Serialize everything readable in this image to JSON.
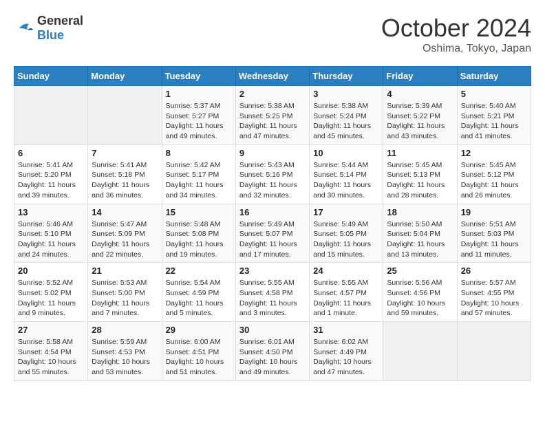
{
  "logo": {
    "general": "General",
    "blue": "Blue"
  },
  "title": {
    "month_year": "October 2024",
    "location": "Oshima, Tokyo, Japan"
  },
  "weekdays": [
    "Sunday",
    "Monday",
    "Tuesday",
    "Wednesday",
    "Thursday",
    "Friday",
    "Saturday"
  ],
  "weeks": [
    [
      {
        "day": "",
        "detail": ""
      },
      {
        "day": "",
        "detail": ""
      },
      {
        "day": "1",
        "detail": "Sunrise: 5:37 AM\nSunset: 5:27 PM\nDaylight: 11 hours and 49 minutes."
      },
      {
        "day": "2",
        "detail": "Sunrise: 5:38 AM\nSunset: 5:25 PM\nDaylight: 11 hours and 47 minutes."
      },
      {
        "day": "3",
        "detail": "Sunrise: 5:38 AM\nSunset: 5:24 PM\nDaylight: 11 hours and 45 minutes."
      },
      {
        "day": "4",
        "detail": "Sunrise: 5:39 AM\nSunset: 5:22 PM\nDaylight: 11 hours and 43 minutes."
      },
      {
        "day": "5",
        "detail": "Sunrise: 5:40 AM\nSunset: 5:21 PM\nDaylight: 11 hours and 41 minutes."
      }
    ],
    [
      {
        "day": "6",
        "detail": "Sunrise: 5:41 AM\nSunset: 5:20 PM\nDaylight: 11 hours and 39 minutes."
      },
      {
        "day": "7",
        "detail": "Sunrise: 5:41 AM\nSunset: 5:18 PM\nDaylight: 11 hours and 36 minutes."
      },
      {
        "day": "8",
        "detail": "Sunrise: 5:42 AM\nSunset: 5:17 PM\nDaylight: 11 hours and 34 minutes."
      },
      {
        "day": "9",
        "detail": "Sunrise: 5:43 AM\nSunset: 5:16 PM\nDaylight: 11 hours and 32 minutes."
      },
      {
        "day": "10",
        "detail": "Sunrise: 5:44 AM\nSunset: 5:14 PM\nDaylight: 11 hours and 30 minutes."
      },
      {
        "day": "11",
        "detail": "Sunrise: 5:45 AM\nSunset: 5:13 PM\nDaylight: 11 hours and 28 minutes."
      },
      {
        "day": "12",
        "detail": "Sunrise: 5:45 AM\nSunset: 5:12 PM\nDaylight: 11 hours and 26 minutes."
      }
    ],
    [
      {
        "day": "13",
        "detail": "Sunrise: 5:46 AM\nSunset: 5:10 PM\nDaylight: 11 hours and 24 minutes."
      },
      {
        "day": "14",
        "detail": "Sunrise: 5:47 AM\nSunset: 5:09 PM\nDaylight: 11 hours and 22 minutes."
      },
      {
        "day": "15",
        "detail": "Sunrise: 5:48 AM\nSunset: 5:08 PM\nDaylight: 11 hours and 19 minutes."
      },
      {
        "day": "16",
        "detail": "Sunrise: 5:49 AM\nSunset: 5:07 PM\nDaylight: 11 hours and 17 minutes."
      },
      {
        "day": "17",
        "detail": "Sunrise: 5:49 AM\nSunset: 5:05 PM\nDaylight: 11 hours and 15 minutes."
      },
      {
        "day": "18",
        "detail": "Sunrise: 5:50 AM\nSunset: 5:04 PM\nDaylight: 11 hours and 13 minutes."
      },
      {
        "day": "19",
        "detail": "Sunrise: 5:51 AM\nSunset: 5:03 PM\nDaylight: 11 hours and 11 minutes."
      }
    ],
    [
      {
        "day": "20",
        "detail": "Sunrise: 5:52 AM\nSunset: 5:02 PM\nDaylight: 11 hours and 9 minutes."
      },
      {
        "day": "21",
        "detail": "Sunrise: 5:53 AM\nSunset: 5:00 PM\nDaylight: 11 hours and 7 minutes."
      },
      {
        "day": "22",
        "detail": "Sunrise: 5:54 AM\nSunset: 4:59 PM\nDaylight: 11 hours and 5 minutes."
      },
      {
        "day": "23",
        "detail": "Sunrise: 5:55 AM\nSunset: 4:58 PM\nDaylight: 11 hours and 3 minutes."
      },
      {
        "day": "24",
        "detail": "Sunrise: 5:55 AM\nSunset: 4:57 PM\nDaylight: 11 hours and 1 minute."
      },
      {
        "day": "25",
        "detail": "Sunrise: 5:56 AM\nSunset: 4:56 PM\nDaylight: 10 hours and 59 minutes."
      },
      {
        "day": "26",
        "detail": "Sunrise: 5:57 AM\nSunset: 4:55 PM\nDaylight: 10 hours and 57 minutes."
      }
    ],
    [
      {
        "day": "27",
        "detail": "Sunrise: 5:58 AM\nSunset: 4:54 PM\nDaylight: 10 hours and 55 minutes."
      },
      {
        "day": "28",
        "detail": "Sunrise: 5:59 AM\nSunset: 4:53 PM\nDaylight: 10 hours and 53 minutes."
      },
      {
        "day": "29",
        "detail": "Sunrise: 6:00 AM\nSunset: 4:51 PM\nDaylight: 10 hours and 51 minutes."
      },
      {
        "day": "30",
        "detail": "Sunrise: 6:01 AM\nSunset: 4:50 PM\nDaylight: 10 hours and 49 minutes."
      },
      {
        "day": "31",
        "detail": "Sunrise: 6:02 AM\nSunset: 4:49 PM\nDaylight: 10 hours and 47 minutes."
      },
      {
        "day": "",
        "detail": ""
      },
      {
        "day": "",
        "detail": ""
      }
    ]
  ]
}
